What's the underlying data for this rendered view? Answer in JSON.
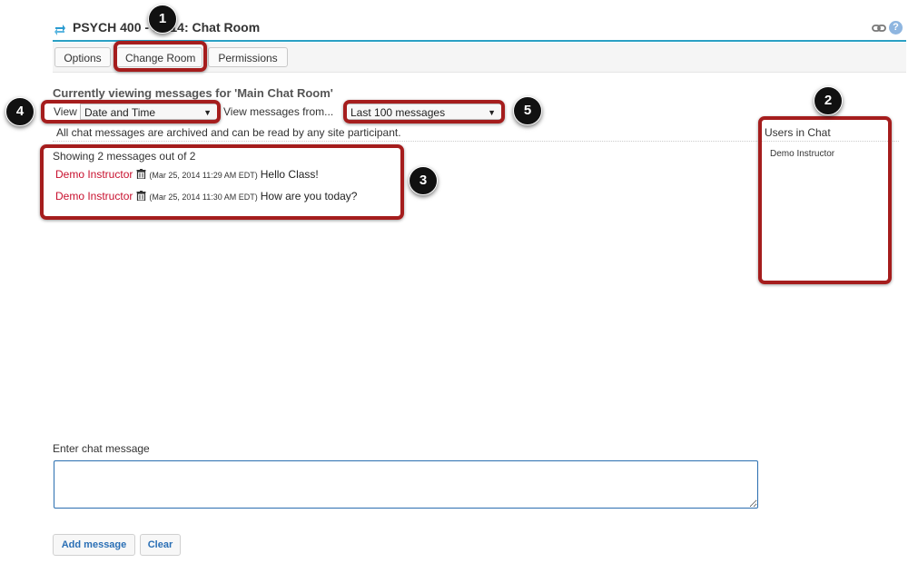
{
  "header": {
    "title": "PSYCH 400 - SU14: Chat Room",
    "help_glyph": "?"
  },
  "toolbar": {
    "options_label": "Options",
    "change_room_label": "Change Room",
    "permissions_label": "Permissions"
  },
  "room": {
    "heading": "Currently viewing messages for 'Main Chat Room'",
    "view_label": "View",
    "view_selected": "Date and Time",
    "view_from_label": "View messages from...",
    "period_selected": "Last 100 messages",
    "archive_note": "All chat messages are archived and can be read by any site participant."
  },
  "users_panel": {
    "title": "Users in Chat",
    "users": [
      "Demo Instructor"
    ]
  },
  "messages": {
    "showing": "Showing 2 messages out of 2",
    "items": [
      {
        "owner": "Demo Instructor",
        "timestamp": "(Mar 25, 2014 11:29 AM EDT)",
        "body": "Hello Class!"
      },
      {
        "owner": "Demo Instructor",
        "timestamp": "(Mar 25, 2014 11:30 AM EDT)",
        "body": "How are you today?"
      }
    ]
  },
  "compose": {
    "label": "Enter chat message",
    "value": "",
    "add_label": "Add message",
    "clear_label": "Clear"
  },
  "callouts": [
    "1",
    "2",
    "3",
    "4",
    "5"
  ],
  "colors": {
    "accent": "#2aa0c4",
    "owner": "#c8102e",
    "callout": "#a51d1d",
    "button_text": "#2a6fb5"
  },
  "icons": {
    "title": "sync-arrows-icon",
    "link": "link-icon",
    "help": "help-icon",
    "delete": "trash-icon",
    "dropdown": "triangle-down-icon"
  }
}
